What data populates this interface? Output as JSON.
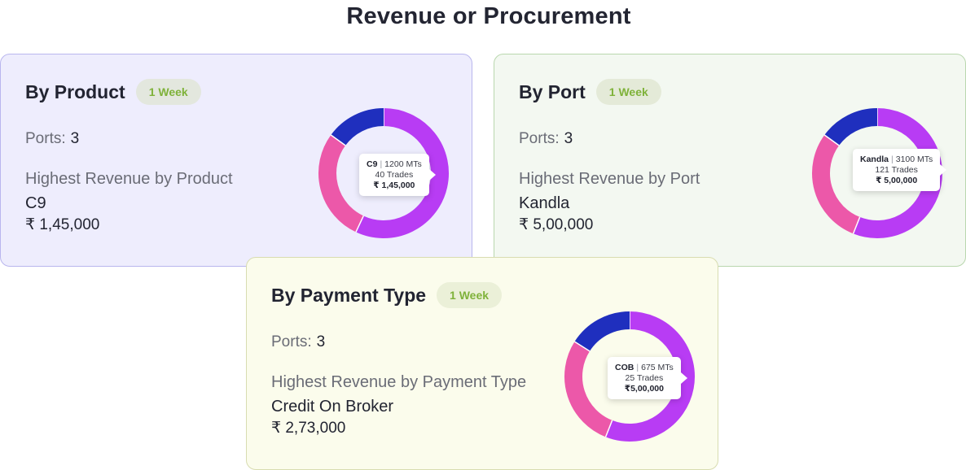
{
  "page": {
    "title": "Revenue or Procurement"
  },
  "colors": {
    "segment_purple": "#b83cf4",
    "segment_pink": "#ec58a9",
    "segment_blue": "#1f2fbe",
    "badge_text": "#7fb23a"
  },
  "cards": [
    {
      "id": "product",
      "title": "By Product",
      "period": "1 Week",
      "ports_label": "Ports:",
      "ports_value": "3",
      "highest_label": "Highest Revenue by Product",
      "highest_name": "C9",
      "highest_amount": "₹ 1,45,000",
      "tooltip": {
        "name": "C9",
        "qty": "1200 MTs",
        "trades": "40 Trades",
        "amount": "₹ 1,45,000"
      },
      "chart_data": {
        "type": "pie",
        "segments": [
          {
            "color": "#b83cf4",
            "value": 0.57
          },
          {
            "color": "#ec58a9",
            "value": 0.28
          },
          {
            "color": "#1f2fbe",
            "value": 0.15
          }
        ]
      }
    },
    {
      "id": "port",
      "title": "By Port",
      "period": "1 Week",
      "ports_label": "Ports:",
      "ports_value": "3",
      "highest_label": "Highest Revenue by Port",
      "highest_name": "Kandla",
      "highest_amount": "₹ 5,00,000",
      "tooltip": {
        "name": "Kandla",
        "qty": "3100 MTs",
        "trades": "121 Trades",
        "amount": "₹ 5,00,000"
      },
      "chart_data": {
        "type": "pie",
        "segments": [
          {
            "color": "#b83cf4",
            "value": 0.56
          },
          {
            "color": "#ec58a9",
            "value": 0.29
          },
          {
            "color": "#1f2fbe",
            "value": 0.15
          }
        ]
      }
    },
    {
      "id": "payment",
      "title": "By Payment Type",
      "period": "1 Week",
      "ports_label": "Ports:",
      "ports_value": "3",
      "highest_label": "Highest Revenue by Payment Type",
      "highest_name": "Credit On Broker",
      "highest_amount": "₹ 2,73,000",
      "tooltip": {
        "name": "COB",
        "qty": "675 MTs",
        "trades": "25 Trades",
        "amount": "₹5,00,000"
      },
      "chart_data": {
        "type": "pie",
        "segments": [
          {
            "color": "#b83cf4",
            "value": 0.56
          },
          {
            "color": "#ec58a9",
            "value": 0.28
          },
          {
            "color": "#1f2fbe",
            "value": 0.16
          }
        ]
      }
    }
  ]
}
